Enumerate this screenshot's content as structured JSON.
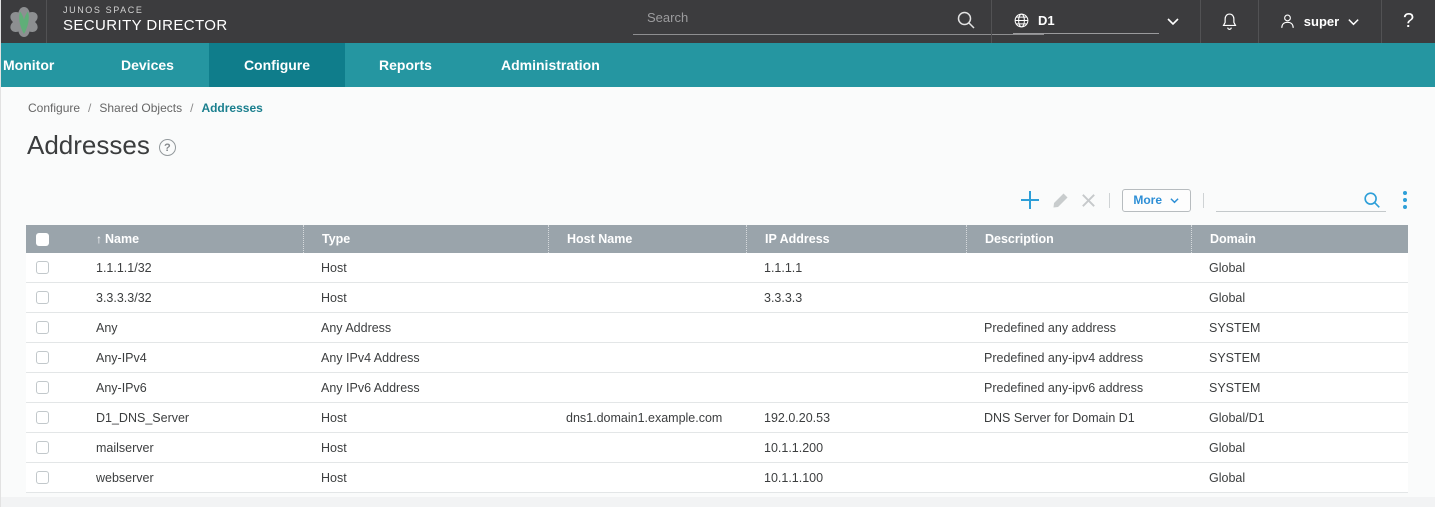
{
  "brand": {
    "product": "JUNOS SPACE",
    "name": "SECURITY DIRECTOR"
  },
  "topbar": {
    "search_placeholder": "Search",
    "domain_label": "D1",
    "username": "super",
    "help_label": "?"
  },
  "nav": {
    "tabs": [
      {
        "label": "Monitor",
        "active": false
      },
      {
        "label": "Devices",
        "active": false
      },
      {
        "label": "Configure",
        "active": true
      },
      {
        "label": "Reports",
        "active": false
      },
      {
        "label": "Administration",
        "active": false
      }
    ]
  },
  "breadcrumb": {
    "items": [
      "Configure",
      "Shared Objects",
      "Addresses"
    ],
    "separator": "/"
  },
  "page": {
    "title": "Addresses",
    "help_icon": "?"
  },
  "toolbar": {
    "more_label": "More",
    "search_value": ""
  },
  "table": {
    "sort_icon": "↑",
    "sorted_column": "Name",
    "columns": [
      "Name",
      "Type",
      "Host Name",
      "IP Address",
      "Description",
      "Domain"
    ],
    "rows": [
      {
        "name": "1.1.1.1/32",
        "type": "Host",
        "host_name": "",
        "ip_address": "1.1.1.1",
        "description": "",
        "domain": "Global"
      },
      {
        "name": "3.3.3.3/32",
        "type": "Host",
        "host_name": "",
        "ip_address": "3.3.3.3",
        "description": "",
        "domain": "Global"
      },
      {
        "name": "Any",
        "type": "Any Address",
        "host_name": "",
        "ip_address": "",
        "description": "Predefined any address",
        "domain": "SYSTEM"
      },
      {
        "name": "Any-IPv4",
        "type": "Any IPv4 Address",
        "host_name": "",
        "ip_address": "",
        "description": "Predefined any-ipv4 address",
        "domain": "SYSTEM"
      },
      {
        "name": "Any-IPv6",
        "type": "Any IPv6 Address",
        "host_name": "",
        "ip_address": "",
        "description": "Predefined any-ipv6 address",
        "domain": "SYSTEM"
      },
      {
        "name": "D1_DNS_Server",
        "type": "Host",
        "host_name": "dns1.domain1.example.com",
        "ip_address": "192.0.20.53",
        "description": "DNS Server for Domain D1",
        "domain": "Global/D1"
      },
      {
        "name": "mailserver",
        "type": "Host",
        "host_name": "",
        "ip_address": "10.1.1.200",
        "description": "",
        "domain": "Global"
      },
      {
        "name": "webserver",
        "type": "Host",
        "host_name": "",
        "ip_address": "10.1.1.100",
        "description": "",
        "domain": "Global"
      }
    ]
  },
  "colors": {
    "topbar_bg": "#3c3c3e",
    "nav_teal": "#2596a1",
    "nav_active_teal": "#0f7d8b",
    "header_gray": "#9aa4ab",
    "accent_blue": "#2e9fd8",
    "breadcrumb_active_teal": "#1a7f8e",
    "logo_green": "#5fae78"
  }
}
